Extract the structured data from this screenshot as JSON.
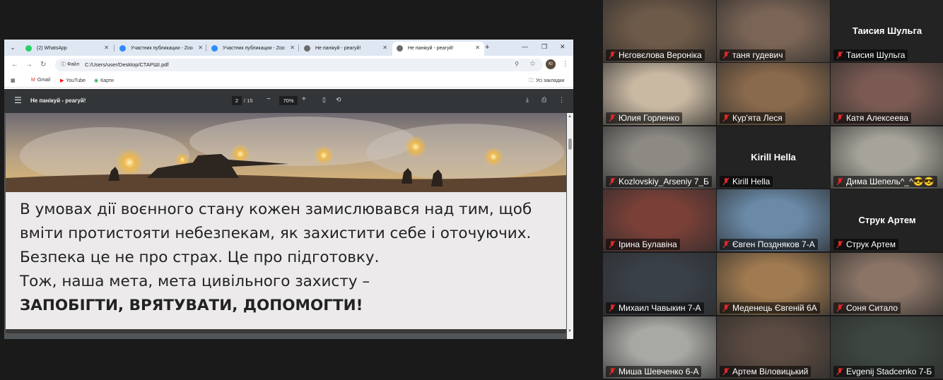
{
  "browser": {
    "tabs": [
      {
        "label": "(2) WhatsApp",
        "favicon_color": "#25d366"
      },
      {
        "label": "Участник публикации - Zoo",
        "favicon_color": "#2d8cff"
      },
      {
        "label": "Участник публикации - Zoo",
        "favicon_color": "#2d8cff"
      },
      {
        "label": "Не панікуй - реагуй!",
        "favicon_color": "#6b6b6b"
      },
      {
        "label": "Не панікуй - реагуй!",
        "favicon_color": "#6b6b6b"
      }
    ],
    "active_tab": 4,
    "omnibox": {
      "chip": "Файл",
      "url": "C:/Users/user/Desktop/СТАРШІ.pdf"
    },
    "profile_initials": "KI",
    "bookmarks": [
      "Gmail",
      "YouTube",
      "Карти"
    ],
    "all_bookmarks_label": "Усі закладки"
  },
  "pdf": {
    "title": "Не панікуй - реагуй!",
    "page": "2",
    "page_total": "/ 15",
    "zoom": "70%"
  },
  "slide": {
    "lines": [
      "В умовах дії воєнного стану кожен замислювався над тим, щоб",
      "вміти протистояти небезпекам, як захистити себе і оточуючих.",
      "Безпека це не про страх. Це про підготовку.",
      "Тож, наша мета, мета цивільного захисту –"
    ],
    "strong_line": "ЗАПОБІГТИ, ВРЯТУВАТИ, ДОПОМОГТИ!"
  },
  "participants": [
    {
      "name": "Нєговєлова Вероніка",
      "video": true,
      "bg": "#6e5a48"
    },
    {
      "name": "таня гудевич",
      "video": true,
      "bg": "#7a6455"
    },
    {
      "name": "Таисия Шульга",
      "video": false,
      "big_name": "Таисия Шульга"
    },
    {
      "name": "Юлия Горленко",
      "video": true,
      "bg": "#c9b9a3",
      "talking": true
    },
    {
      "name": "Кур'ята Леся",
      "video": true,
      "bg": "#8a6a4c"
    },
    {
      "name": "Катя Алексеева",
      "video": true,
      "bg": "#7a5a52"
    },
    {
      "name": "Kozlovskiy_Arseniy 7_Б",
      "video": true,
      "bg": "#8d8a84"
    },
    {
      "name": "Kirill Hella",
      "video": false,
      "big_name": "Kirill Hella"
    },
    {
      "name": "Дима Шепель^_^😎😎",
      "video": true,
      "bg": "#a6a49a"
    },
    {
      "name": "Ірина Булавіна",
      "video": true,
      "bg": "#7a4038"
    },
    {
      "name": "Євген Поздняков 7-А",
      "video": true,
      "bg": "#6a8aa8"
    },
    {
      "name": "Струк Артем",
      "video": false,
      "big_name": "Струк Артем"
    },
    {
      "name": "Михаил Чавыкин 7-А",
      "video": true,
      "bg": "#3a4048"
    },
    {
      "name": "Меденець Євгеній 6А",
      "video": true,
      "bg": "#a07a50"
    },
    {
      "name": "Соня Ситало",
      "video": true,
      "bg": "#8a7466"
    },
    {
      "name": "Миша Шевченко 6-А",
      "video": true,
      "bg": "#a8a8a4"
    },
    {
      "name": "Артем Віловицький",
      "video": true,
      "bg": "#5a4a40"
    },
    {
      "name": "Evgenij Stadcenko 7-Б",
      "video": true,
      "bg": "#3d4640"
    }
  ],
  "colors": {
    "talking_outline": "#23d959",
    "muted_mic": "#e02828",
    "pdf_toolbar": "#323639",
    "tabstrip": "#dfe7f3"
  }
}
